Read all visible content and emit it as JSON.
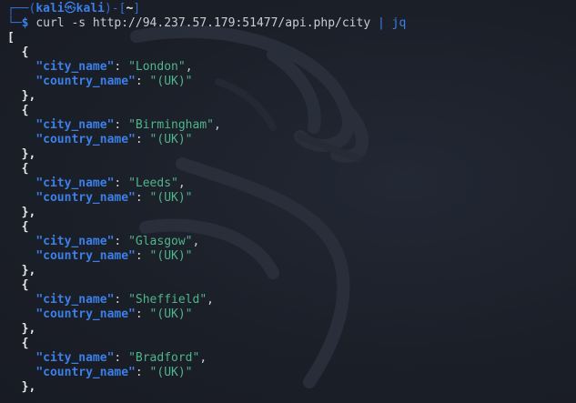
{
  "prompt": {
    "frame_top": "┌──(",
    "user": "kali",
    "at_symbol": "㉿",
    "host": "kali",
    "frame_mid": ")-[",
    "dir": "~",
    "frame_end": "]",
    "frame_bottom": "└─",
    "dollar": "$",
    "command": "curl -s http://94.237.57.179:51477/api.php/city",
    "pipe": "|",
    "pipe_target": "jq"
  },
  "output": {
    "open_array": "[",
    "open_obj": "{",
    "close_obj": "},",
    "key_city": "\"city_name\"",
    "key_country": "\"country_name\"",
    "records": [
      {
        "city": "\"London\"",
        "country": "\"(UK)\""
      },
      {
        "city": "\"Birmingham\"",
        "country": "\"(UK)\""
      },
      {
        "city": "\"Leeds\"",
        "country": "\"(UK)\""
      },
      {
        "city": "\"Glasgow\"",
        "country": "\"(UK)\""
      },
      {
        "city": "\"Sheffield\"",
        "country": "\"(UK)\""
      },
      {
        "city": "\"Bradford\"",
        "country": "\"(UK)\""
      }
    ]
  },
  "colors": {
    "background": "#1d222c",
    "prompt_blue": "#3b7fe8",
    "string_green": "#4fb58a",
    "text": "#c8ccd4"
  },
  "icons": {
    "background": "kali-dragon-watermark"
  }
}
